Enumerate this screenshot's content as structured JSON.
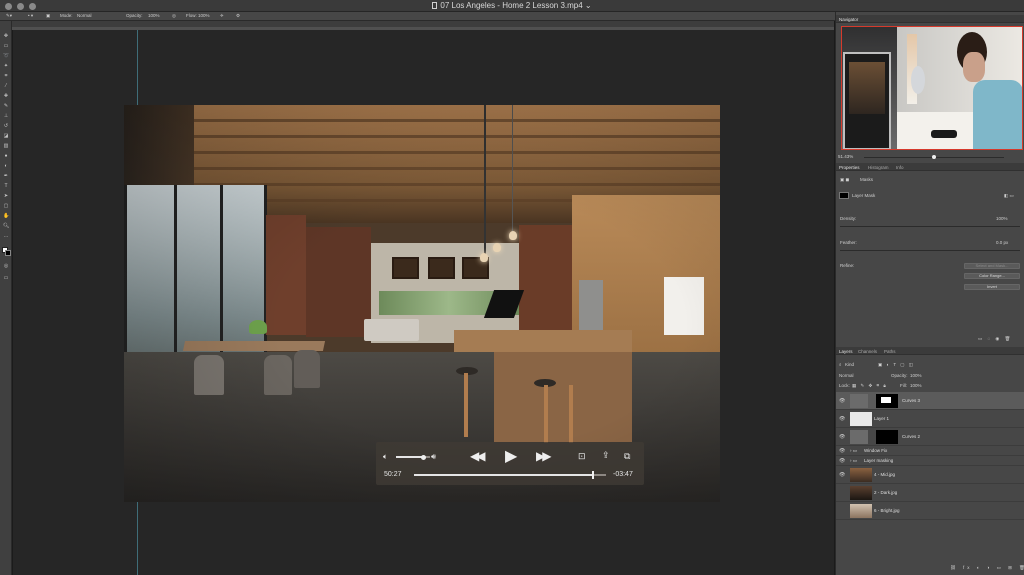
{
  "window": {
    "title": "07 Los Angeles - Home 2 Lesson 3.mp4",
    "title_chevron": "⌄"
  },
  "options_bar": {
    "mode_label": "Mode:",
    "mode_value": "Normal",
    "opacity_label": "Opacity:",
    "opacity_value": "100%",
    "flow_label": "Flow:",
    "flow_value": "100%"
  },
  "video_player": {
    "elapsed": "50:27",
    "remaining": "-03:47",
    "volume_fraction": 0.8,
    "progress_fraction": 0.93
  },
  "navigator": {
    "tab": "Navigator",
    "zoom": "51.43%"
  },
  "properties": {
    "tabs": [
      "Properties",
      "Histogram",
      "Info"
    ],
    "section_title": "Masks",
    "mask_type": "Layer Mask",
    "density_label": "Density:",
    "density_value": "100%",
    "feather_label": "Feather:",
    "feather_value": "0.0 px",
    "refine_label": "Refine:",
    "buttons": [
      "Select and Mask...",
      "Color Range...",
      "Invert"
    ]
  },
  "layers_panel": {
    "tabs": [
      "Layers",
      "Channels",
      "Paths"
    ],
    "filter_label": "Kind",
    "blend_mode": "Normal",
    "opacity_label": "Opacity:",
    "opacity_value": "100%",
    "lock_label": "Lock:",
    "fill_label": "Fill:",
    "fill_value": "100%",
    "layers": [
      {
        "name": "Curves 3",
        "type": "adjustment",
        "selected": true
      },
      {
        "name": "Layer 1",
        "type": "pixel",
        "selected": false
      },
      {
        "name": "Curves 2",
        "type": "adjustment",
        "selected": false
      },
      {
        "name": "Window Fix",
        "type": "group",
        "selected": false
      },
      {
        "name": "Layer masking",
        "type": "group",
        "selected": false
      },
      {
        "name": "4 - Mid.jpg",
        "type": "image",
        "selected": false
      },
      {
        "name": "2 - Dark.jpg",
        "type": "image",
        "selected": false
      },
      {
        "name": "6 - Bright.jpg",
        "type": "image",
        "selected": false
      }
    ]
  },
  "colors": {
    "panel_bg": "#474747",
    "canvas_bg": "#262626",
    "selected_layer": "#5b5b5b"
  }
}
